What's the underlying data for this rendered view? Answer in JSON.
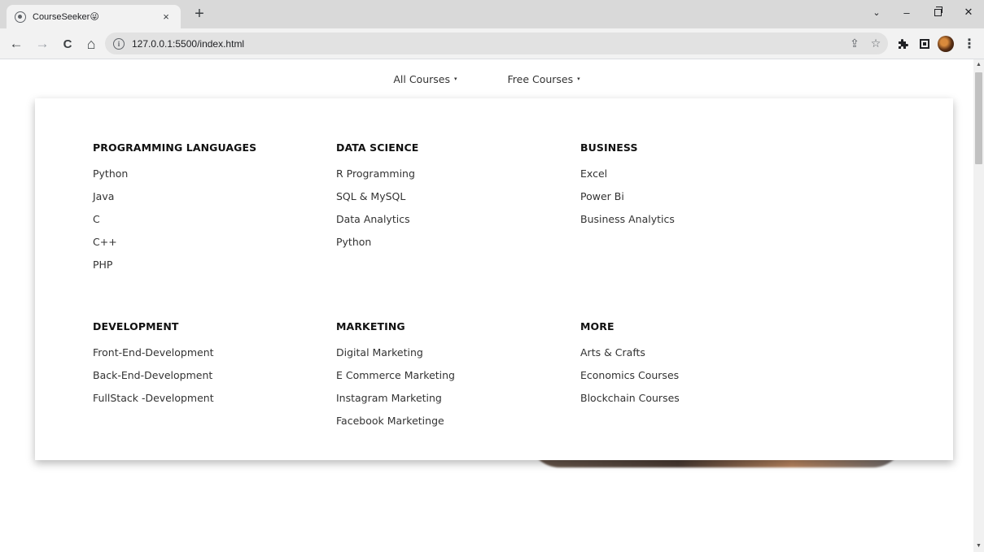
{
  "browser": {
    "tab": {
      "title": "CourseSeeker😜",
      "close": "×"
    },
    "new_tab": "+",
    "window_controls": {
      "chevron": "⌄",
      "minimize": "–",
      "close": "✕"
    },
    "nav": {
      "back": "←",
      "forward": "→",
      "reload": "C",
      "home": "⌂"
    },
    "url": "127.0.0.1:5500/index.html",
    "omnibox_icons": {
      "share": "⇪",
      "bookmark": "☆"
    },
    "extensions_icon": "puzzle-icon",
    "menu": "⋮"
  },
  "page": {
    "nav": [
      {
        "label": "All Courses",
        "caret": "▾"
      },
      {
        "label": "Free Courses",
        "caret": "▾"
      }
    ],
    "mega_menu": {
      "columns": [
        {
          "title": "PROGRAMMING LANGUAGES",
          "items": [
            "Python",
            "Java",
            "C",
            "C++",
            "PHP"
          ]
        },
        {
          "title": "DATA SCIENCE",
          "items": [
            "R Programming",
            "SQL & MySQL",
            "Data Analytics",
            "Python"
          ]
        },
        {
          "title": "BUSINESS",
          "items": [
            "Excel",
            "Power Bi",
            "Business Analytics"
          ]
        },
        {
          "title": "DEVELOPMENT",
          "items": [
            "Front-End-Development",
            "Back-End-Development",
            "FullStack -Development"
          ]
        },
        {
          "title": "MARKETING",
          "items": [
            "Digital Marketing",
            "E Commerce Marketing",
            "Instagram Marketing",
            "Facebook Marketinge"
          ]
        },
        {
          "title": "MORE",
          "items": [
            "Arts & Crafts",
            "Economics Courses",
            "Blockchain Courses"
          ]
        }
      ]
    }
  }
}
